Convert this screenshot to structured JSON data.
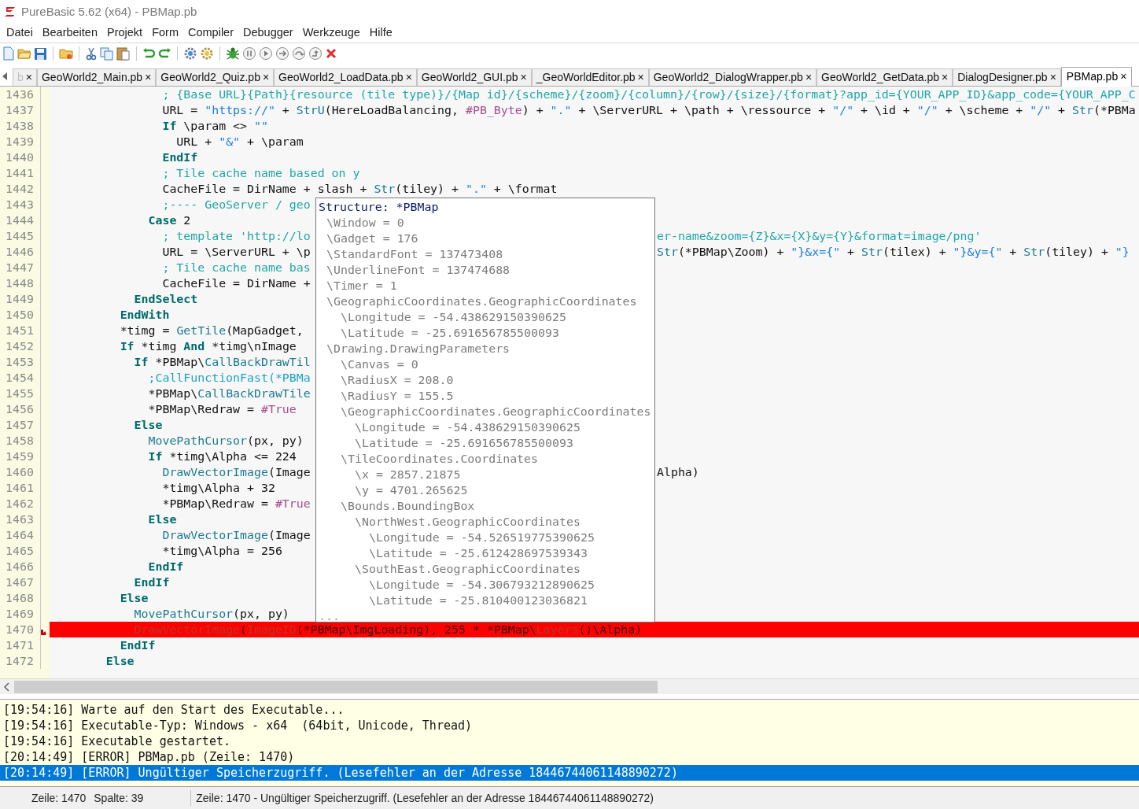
{
  "window": {
    "title": "PureBasic 5.62 (x64) - PBMap.pb"
  },
  "menu": [
    "Datei",
    "Bearbeiten",
    "Projekt",
    "Form",
    "Compiler",
    "Debugger",
    "Werkzeuge",
    "Hilfe"
  ],
  "tabs": [
    {
      "label": "b",
      "kind": "partial",
      "selected": false
    },
    {
      "label": "GeoWorld2_Main.pb",
      "kind": "file",
      "selected": false
    },
    {
      "label": "GeoWorld2_Quiz.pb",
      "kind": "file",
      "selected": false
    },
    {
      "label": "GeoWorld2_LoadData.pb",
      "kind": "file",
      "selected": false
    },
    {
      "label": "GeoWorld2_GUI.pb",
      "kind": "file",
      "selected": false
    },
    {
      "label": "_GeoWorldEditor.pb",
      "kind": "file",
      "selected": false
    },
    {
      "label": "GeoWorld2_DialogWrapper.pb",
      "kind": "file",
      "selected": false
    },
    {
      "label": "GeoWorld2_GetData.pb",
      "kind": "file",
      "selected": false
    },
    {
      "label": "DialogDesigner.pb",
      "kind": "file",
      "selected": false
    },
    {
      "label": "PBMap.pb",
      "kind": "file",
      "selected": true
    }
  ],
  "tab_close": "×",
  "editor": {
    "lines": [
      {
        "number": "1436",
        "error": false,
        "parts": [
          {
            "kind": "cm",
            "text": "                ; {Base URL}{Path}{resource (tile type)}/{Map id}/{scheme}/{zoom}/{column}/{row}/{size}/{format}?app_id={YOUR_APP_ID}&app_code={YOUR_APP_C"
          }
        ]
      },
      {
        "number": "1437",
        "error": false,
        "parts": [
          {
            "kind": "tx",
            "text": "                URL = "
          },
          {
            "kind": "st",
            "text": "\"https://\""
          },
          {
            "kind": "tx",
            "text": " + "
          },
          {
            "kind": "fn",
            "text": "StrU"
          },
          {
            "kind": "tx",
            "text": "(HereLoadBalancing, "
          },
          {
            "kind": "co",
            "text": "#PB_Byte"
          },
          {
            "kind": "tx",
            "text": ") + "
          },
          {
            "kind": "st",
            "text": "\".\""
          },
          {
            "kind": "tx",
            "text": " + \\ServerURL + \\path + \\ressource + "
          },
          {
            "kind": "st",
            "text": "\"/\""
          },
          {
            "kind": "tx",
            "text": " + \\id + "
          },
          {
            "kind": "st",
            "text": "\"/\""
          },
          {
            "kind": "tx",
            "text": " + \\scheme + "
          },
          {
            "kind": "st",
            "text": "\"/\""
          },
          {
            "kind": "tx",
            "text": " + "
          },
          {
            "kind": "fn",
            "text": "Str"
          },
          {
            "kind": "tx",
            "text": "(*PBMa"
          }
        ]
      },
      {
        "number": "1438",
        "error": false,
        "parts": [
          {
            "kind": "kw",
            "text": "                If"
          },
          {
            "kind": "tx",
            "text": " \\param <> "
          },
          {
            "kind": "st",
            "text": "\"\""
          }
        ]
      },
      {
        "number": "1439",
        "error": false,
        "parts": [
          {
            "kind": "tx",
            "text": "                  URL + "
          },
          {
            "kind": "st",
            "text": "\"&\""
          },
          {
            "kind": "tx",
            "text": " + \\param"
          }
        ]
      },
      {
        "number": "1440",
        "error": false,
        "parts": [
          {
            "kind": "kw",
            "text": "                EndIf"
          }
        ]
      },
      {
        "number": "1441",
        "error": false,
        "parts": [
          {
            "kind": "cm",
            "text": "                ; Tile cache name based on y"
          }
        ]
      },
      {
        "number": "1442",
        "error": false,
        "parts": [
          {
            "kind": "tx",
            "text": "                CacheFile = DirName + slash + "
          },
          {
            "kind": "fn",
            "text": "Str"
          },
          {
            "kind": "tx",
            "text": "(tiley) + "
          },
          {
            "kind": "st",
            "text": "\".\""
          },
          {
            "kind": "tx",
            "text": " + \\format"
          }
        ]
      },
      {
        "number": "1443",
        "error": false,
        "parts": [
          {
            "kind": "cm",
            "text": "                ;---- GeoServer / geo"
          }
        ]
      },
      {
        "number": "1444",
        "error": false,
        "parts": [
          {
            "kind": "kw",
            "text": "              Case"
          },
          {
            "kind": "tx",
            "text": " 2"
          }
        ]
      },
      {
        "number": "1445",
        "error": false,
        "parts": [
          {
            "kind": "cm",
            "text": "                ; template 'http://lo"
          }
        ],
        "right": [
          {
            "kind": "cm",
            "text": "er-name&zoom={Z}&x={X}&y={Y}&format=image/png'"
          }
        ]
      },
      {
        "number": "1446",
        "error": false,
        "parts": [
          {
            "kind": "tx",
            "text": "                URL = \\ServerURL + \\p"
          }
        ],
        "right": [
          {
            "kind": "fn",
            "text": "Str"
          },
          {
            "kind": "tx",
            "text": "(*PBMap\\Zoom) + "
          },
          {
            "kind": "st",
            "text": "\"}&x={\""
          },
          {
            "kind": "tx",
            "text": " + "
          },
          {
            "kind": "fn",
            "text": "Str"
          },
          {
            "kind": "tx",
            "text": "(tilex) + "
          },
          {
            "kind": "st",
            "text": "\"}&y={\""
          },
          {
            "kind": "tx",
            "text": " + "
          },
          {
            "kind": "fn",
            "text": "Str"
          },
          {
            "kind": "tx",
            "text": "(tiley) + "
          },
          {
            "kind": "st",
            "text": "\"}"
          }
        ]
      },
      {
        "number": "1447",
        "error": false,
        "parts": [
          {
            "kind": "cm",
            "text": "                ; Tile cache name bas"
          }
        ]
      },
      {
        "number": "1448",
        "error": false,
        "parts": [
          {
            "kind": "tx",
            "text": "                CacheFile = DirName +"
          }
        ]
      },
      {
        "number": "1449",
        "error": false,
        "parts": [
          {
            "kind": "kw",
            "text": "            EndSelect"
          }
        ]
      },
      {
        "number": "1450",
        "error": false,
        "parts": [
          {
            "kind": "kw",
            "text": "          EndWith"
          }
        ]
      },
      {
        "number": "1451",
        "error": false,
        "parts": [
          {
            "kind": "tx",
            "text": "          *timg = "
          },
          {
            "kind": "fn",
            "text": "GetTile"
          },
          {
            "kind": "tx",
            "text": "(MapGadget,"
          }
        ]
      },
      {
        "number": "1452",
        "error": false,
        "parts": [
          {
            "kind": "kw",
            "text": "          If"
          },
          {
            "kind": "tx",
            "text": " *timg "
          },
          {
            "kind": "kw",
            "text": "And"
          },
          {
            "kind": "tx",
            "text": " *timg\\nImage"
          }
        ]
      },
      {
        "number": "1453",
        "error": false,
        "parts": [
          {
            "kind": "kw",
            "text": "            If"
          },
          {
            "kind": "tx",
            "text": " *PBMap\\"
          },
          {
            "kind": "fn",
            "text": "CallBackDrawTil"
          }
        ]
      },
      {
        "number": "1454",
        "error": false,
        "parts": [
          {
            "kind": "cf",
            "text": "              ;CallFunctionFast(*PBMa"
          }
        ]
      },
      {
        "number": "1455",
        "error": false,
        "parts": [
          {
            "kind": "tx",
            "text": "              *PBMap\\"
          },
          {
            "kind": "fn",
            "text": "CallBackDrawTile"
          }
        ]
      },
      {
        "number": "1456",
        "error": false,
        "parts": [
          {
            "kind": "tx",
            "text": "              *PBMap\\Redraw = "
          },
          {
            "kind": "co",
            "text": "#True"
          }
        ]
      },
      {
        "number": "1457",
        "error": false,
        "parts": [
          {
            "kind": "kw",
            "text": "            Else"
          }
        ]
      },
      {
        "number": "1458",
        "error": false,
        "parts": [
          {
            "kind": "fn",
            "text": "              MovePathCursor"
          },
          {
            "kind": "tx",
            "text": "(px, py)"
          }
        ]
      },
      {
        "number": "1459",
        "error": false,
        "parts": [
          {
            "kind": "kw",
            "text": "              If"
          },
          {
            "kind": "tx",
            "text": " *timg\\Alpha <= 224"
          }
        ]
      },
      {
        "number": "1460",
        "error": false,
        "parts": [
          {
            "kind": "fn",
            "text": "                DrawVectorImage"
          },
          {
            "kind": "tx",
            "text": "(Image"
          }
        ],
        "right": [
          {
            "kind": "tx",
            "text": "Alpha)"
          }
        ]
      },
      {
        "number": "1461",
        "error": false,
        "parts": [
          {
            "kind": "tx",
            "text": "                *timg\\Alpha + 32"
          }
        ]
      },
      {
        "number": "1462",
        "error": false,
        "parts": [
          {
            "kind": "tx",
            "text": "                *PBMap\\Redraw = "
          },
          {
            "kind": "co",
            "text": "#True"
          }
        ]
      },
      {
        "number": "1463",
        "error": false,
        "parts": [
          {
            "kind": "kw",
            "text": "              Else"
          }
        ]
      },
      {
        "number": "1464",
        "error": false,
        "parts": [
          {
            "kind": "fn",
            "text": "                DrawVectorImage"
          },
          {
            "kind": "tx",
            "text": "(Image"
          }
        ]
      },
      {
        "number": "1465",
        "error": false,
        "parts": [
          {
            "kind": "tx",
            "text": "                *timg\\Alpha = 256"
          }
        ]
      },
      {
        "number": "1466",
        "error": false,
        "parts": [
          {
            "kind": "kw",
            "text": "              EndIf"
          }
        ]
      },
      {
        "number": "1467",
        "error": false,
        "parts": [
          {
            "kind": "kw",
            "text": "            EndIf"
          }
        ]
      },
      {
        "number": "1468",
        "error": false,
        "parts": [
          {
            "kind": "kw",
            "text": "          Else"
          }
        ]
      },
      {
        "number": "1469",
        "error": false,
        "parts": [
          {
            "kind": "fn",
            "text": "            MovePathCursor"
          },
          {
            "kind": "tx",
            "text": "(px, py)"
          }
        ]
      },
      {
        "number": "1470",
        "error": true,
        "parts": [
          {
            "kind": "fn",
            "text": "            DrawVectorImage"
          },
          {
            "kind": "tx",
            "text": "("
          },
          {
            "kind": "fn",
            "text": "ImageID"
          },
          {
            "kind": "tx",
            "text": "(*PBMap\\ImgLoading), 255 * *PBMap\\"
          },
          {
            "kind": "fn",
            "text": "Layers"
          },
          {
            "kind": "tx",
            "text": "()\\Alpha)"
          }
        ]
      },
      {
        "number": "1471",
        "error": false,
        "parts": [
          {
            "kind": "kw",
            "text": "          EndIf"
          }
        ]
      },
      {
        "number": "1472",
        "error": false,
        "parts": [
          {
            "kind": "kw",
            "text": "        Else"
          }
        ]
      }
    ]
  },
  "tooltip": {
    "title": "Structure: *PBMap",
    "items": [
      {
        "text": "\\Window = 0"
      },
      {
        "text": "\\Gadget = 176"
      },
      {
        "text": "\\StandardFont = 137473408"
      },
      {
        "text": "\\UnderlineFont = 137474688"
      },
      {
        "text": "\\Timer = 1"
      },
      {
        "text": "\\GeographicCoordinates.GeographicCoordinates",
        "children": [
          {
            "text": "\\Longitude = -54.438629150390625"
          },
          {
            "text": "\\Latitude = -25.691656785500093"
          }
        ]
      },
      {
        "text": "\\Drawing.DrawingParameters",
        "children": [
          {
            "text": "\\Canvas = 0"
          },
          {
            "text": "\\RadiusX = 208.0"
          },
          {
            "text": "\\RadiusY = 155.5"
          },
          {
            "text": "\\GeographicCoordinates.GeographicCoordinates",
            "children": [
              {
                "text": "\\Longitude = -54.438629150390625"
              },
              {
                "text": "\\Latitude = -25.691656785500093"
              }
            ]
          },
          {
            "text": "\\TileCoordinates.Coordinates",
            "children": [
              {
                "text": "\\x = 2857.21875"
              },
              {
                "text": "\\y = 4701.265625"
              }
            ]
          },
          {
            "text": "\\Bounds.BoundingBox",
            "children": [
              {
                "text": "\\NorthWest.GeographicCoordinates",
                "children": [
                  {
                    "text": "\\Longitude = -54.526519775390625"
                  },
                  {
                    "text": "\\Latitude = -25.612428697539343"
                  }
                ]
              },
              {
                "text": "\\SouthEast.GeographicCoordinates",
                "children": [
                  {
                    "text": "\\Longitude = -54.306793212890625"
                  },
                  {
                    "text": "\\Latitude = -25.810400123036821"
                  }
                ]
              }
            ]
          }
        ]
      }
    ],
    "more": "..."
  },
  "output": [
    {
      "text": "[19:54:16] Warte auf den Start des Executable...",
      "selected": false
    },
    {
      "text": "[19:54:16] Executable-Typ: Windows - x64  (64bit, Unicode, Thread)",
      "selected": false
    },
    {
      "text": "[19:54:16] Executable gestartet.",
      "selected": false
    },
    {
      "text": "[20:14:49] [ERROR] PBMap.pb (Zeile: 1470)",
      "selected": false
    },
    {
      "text": "[20:14:49] [ERROR] Ungültiger Speicherzugriff. (Lesefehler an der Adresse 18446744061148890272)",
      "selected": true
    }
  ],
  "status_bar": {
    "line": "Zeile: 1470",
    "column": "Spalte: 39",
    "message": "Zeile: 1470 - Ungültiger Speicherzugriff. (Lesefehler an der Adresse 18446744061148890272)"
  }
}
